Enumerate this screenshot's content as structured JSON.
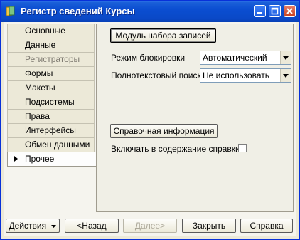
{
  "window": {
    "title": "Регистр сведений Курсы"
  },
  "tabs": [
    {
      "label": "Основные",
      "state": "normal"
    },
    {
      "label": "Данные",
      "state": "normal"
    },
    {
      "label": "Регистраторы",
      "state": "disabled"
    },
    {
      "label": "Формы",
      "state": "normal"
    },
    {
      "label": "Макеты",
      "state": "normal"
    },
    {
      "label": "Подсистемы",
      "state": "normal"
    },
    {
      "label": "Права",
      "state": "normal"
    },
    {
      "label": "Интерфейсы",
      "state": "normal"
    },
    {
      "label": "Обмен данными",
      "state": "normal"
    },
    {
      "label": "Прочее",
      "state": "active"
    }
  ],
  "panel": {
    "records_module_button": "Модуль набора записей",
    "lock_mode_label": "Режим блокировки",
    "lock_mode_value": "Автоматический",
    "fulltext_label": "Полнотекстовый поиск",
    "fulltext_value": "Не использовать",
    "help_button": "Справочная информация",
    "include_help_label": "Включать в содержание справки",
    "include_help_checked": false
  },
  "footer": {
    "actions_button": "Действия",
    "back_button": "<Назад",
    "next_button": "Далее>",
    "close_button": "Закрыть",
    "help_button": "Справка"
  }
}
